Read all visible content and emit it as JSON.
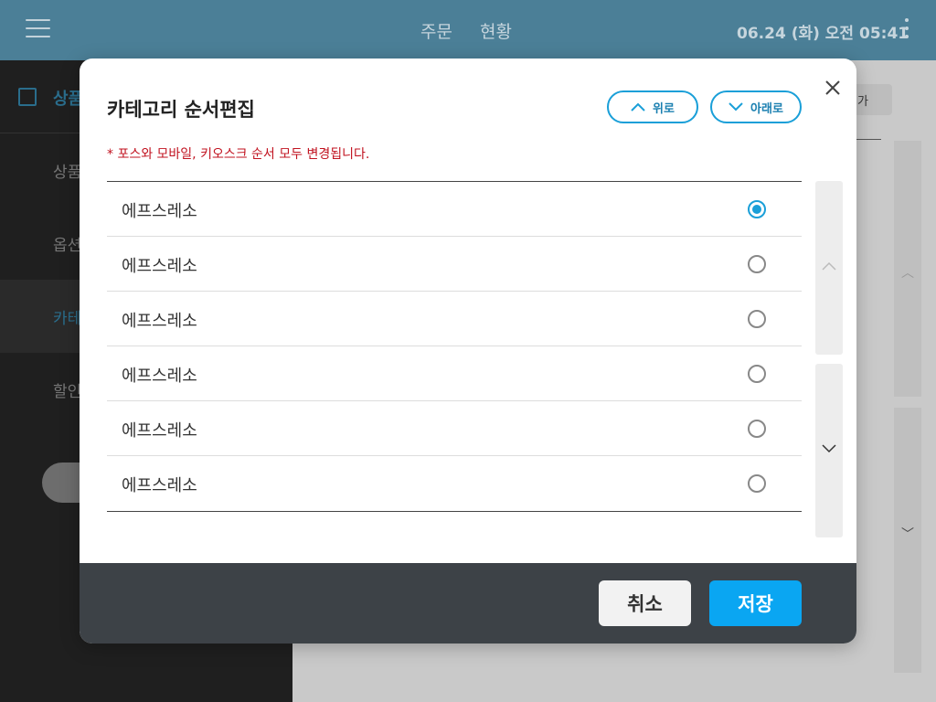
{
  "topbar": {
    "nav": [
      "주문",
      "현황"
    ],
    "datetime": "06.24 (화) 오전 05:41"
  },
  "sidebar": {
    "header": "상품",
    "items": [
      "상품",
      "옵션",
      "카테",
      "할인"
    ]
  },
  "content": {
    "add_button": "가"
  },
  "modal": {
    "title": "카테고리 순서편집",
    "up_label": "위로",
    "down_label": "아래로",
    "notice": "* 포스와 모바일, 키오스크 순서 모두 변경됩니다.",
    "items": [
      {
        "label": "에프스레소",
        "selected": true
      },
      {
        "label": "에프스레소",
        "selected": false
      },
      {
        "label": "에프스레소",
        "selected": false
      },
      {
        "label": "에프스레소",
        "selected": false
      },
      {
        "label": "에프스레소",
        "selected": false
      },
      {
        "label": "에프스레소",
        "selected": false
      }
    ],
    "cancel_label": "취소",
    "save_label": "저장"
  },
  "colors": {
    "accent": "#0aa6f2",
    "notice": "#c1121f",
    "footer": "#3d4247"
  }
}
